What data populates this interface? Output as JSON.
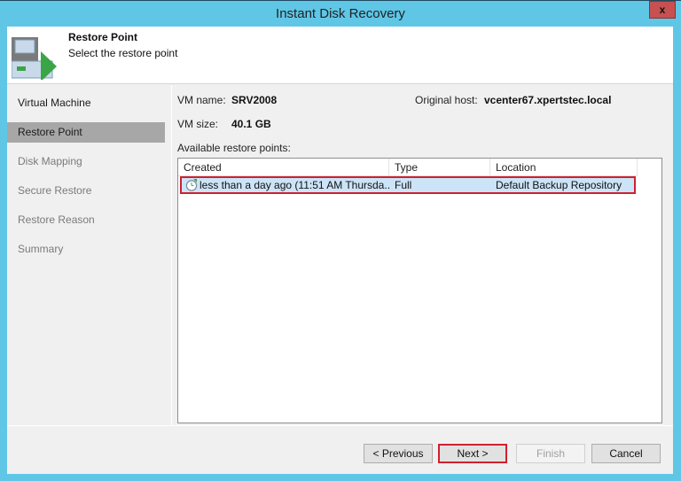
{
  "window": {
    "title": "Instant Disk Recovery",
    "close_label": "x"
  },
  "header": {
    "title": "Restore Point",
    "subtitle": "Select the restore point",
    "icon": "restore-wizard-icon"
  },
  "sidebar": {
    "items": [
      {
        "label": "Virtual Machine",
        "state": "done"
      },
      {
        "label": "Restore Point",
        "state": "active"
      },
      {
        "label": "Disk Mapping",
        "state": "pending"
      },
      {
        "label": "Secure Restore",
        "state": "pending"
      },
      {
        "label": "Restore Reason",
        "state": "pending"
      },
      {
        "label": "Summary",
        "state": "pending"
      }
    ]
  },
  "vm_info": {
    "name_label": "VM name:",
    "name_value": "SRV2008",
    "size_label": "VM size:",
    "size_value": "40.1 GB",
    "host_label": "Original host:",
    "host_value": "vcenter67.xpertstec.local"
  },
  "restore_points": {
    "label": "Available restore points:",
    "columns": [
      "Created",
      "Type",
      "Location"
    ],
    "rows": [
      {
        "created": "less than a day ago (11:51 AM Thursda...",
        "type": "Full",
        "location": "Default Backup Repository",
        "icon": "restore-point-clock-icon",
        "selected": true
      }
    ]
  },
  "buttons": {
    "previous": "< Previous",
    "next": "Next >",
    "finish": "Finish",
    "cancel": "Cancel"
  },
  "colors": {
    "title_bar": "#5fc6e6",
    "highlight": "#d0202f",
    "selection": "#cce4f7",
    "active_nav": "#a7a7a7"
  }
}
